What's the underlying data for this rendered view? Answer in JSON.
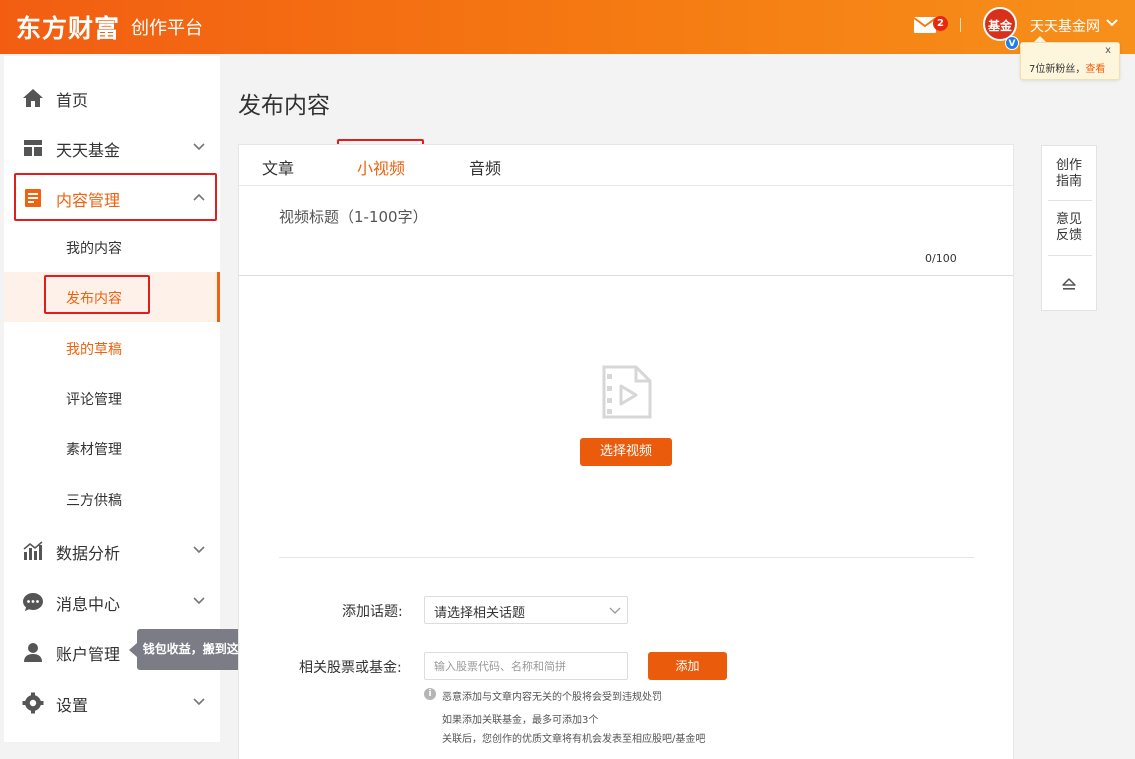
{
  "header": {
    "logo": "东方财富",
    "platform": "创作平台",
    "mail_count": "2",
    "avatar_text": "基金",
    "verified_mark": "V",
    "username": "天天基金网",
    "fan_popup": {
      "close": "x",
      "text": "7位新粉丝，",
      "link": "查看"
    }
  },
  "sidebar": {
    "items": [
      {
        "label": "首页",
        "icon": "home-icon"
      },
      {
        "label": "天天基金",
        "icon": "layout-icon"
      },
      {
        "label": "内容管理",
        "icon": "document-icon"
      },
      {
        "label": "数据分析",
        "icon": "chart-icon"
      },
      {
        "label": "消息中心",
        "icon": "chat-icon"
      },
      {
        "label": "账户管理",
        "icon": "user-icon"
      },
      {
        "label": "设置",
        "icon": "gear-icon"
      }
    ],
    "content_sub": [
      "我的内容",
      "发布内容",
      "我的草稿",
      "评论管理",
      "素材管理",
      "三方供稿"
    ],
    "tooltip": "钱包收益，搬到这里了!"
  },
  "main": {
    "title": "发布内容",
    "tabs": [
      "文章",
      "小视频",
      "音频"
    ],
    "video_title_label": "视频标题（1-100字）",
    "counter": "0/100",
    "select_video": "选择视频",
    "topic_label": "添加话题:",
    "topic_value": "请选择相关话题",
    "stock_label": "相关股票或基金:",
    "stock_placeholder": "输入股票代码、名称和简拼",
    "add": "添加",
    "notes": [
      "恶意添加与文章内容无关的个股将会受到违规处罚",
      "如果添加关联基金，最多可添加3个",
      "关联后，您创作的优质文章将有机会发表至相应股吧/基金吧"
    ]
  },
  "float_bar": {
    "guide": [
      "创作",
      "指南"
    ],
    "feedback": [
      "意见",
      "反馈"
    ]
  },
  "colors": {
    "brand": "#f0620f",
    "button": "#ea5b0c",
    "highlight": "#e01e1e"
  }
}
